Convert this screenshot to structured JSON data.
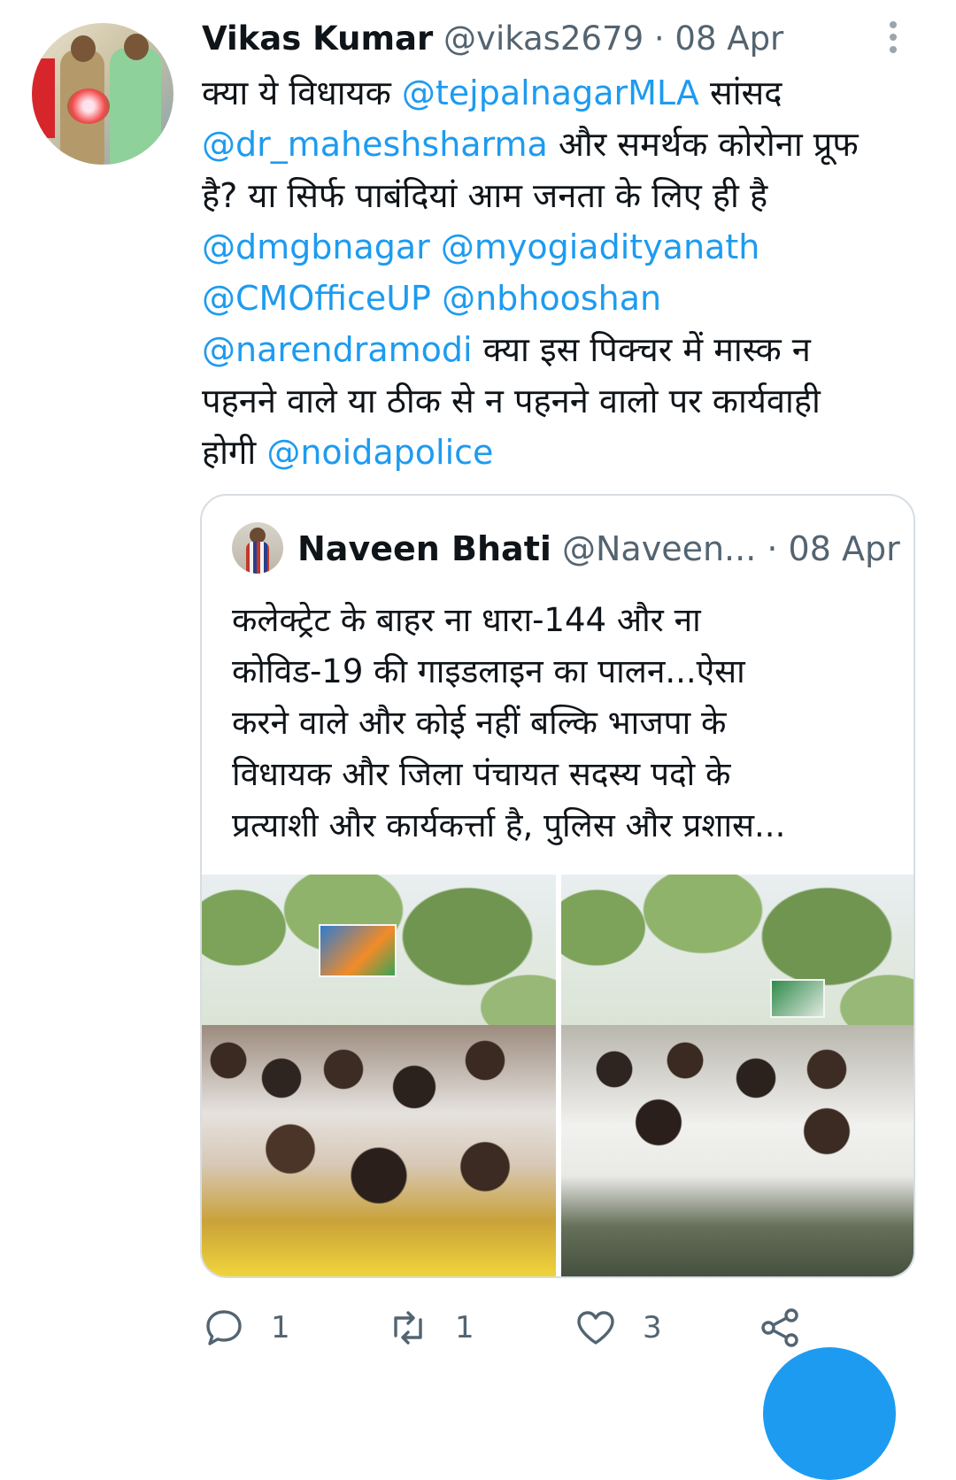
{
  "tweet": {
    "author_name": "Vikas Kumar",
    "author_handle": "@vikas2679",
    "separator": " · ",
    "date": "08 Apr",
    "avatar_icon": "user-avatar-photo",
    "text": {
      "line1_prefix": "क्या ये विधायक ",
      "mention1": "@tejpalnagarMLA",
      "line1_suffix": " सांसद",
      "mention2": "@dr_maheshsharma",
      "line2_suffix": " और समर्थक कोरोना प्रूफ",
      "line3": "है? या सिर्फ पाबंदियां आम जनता के लिए ही है",
      "mention3": "@dmgbnagar",
      "mention4": "@myogiadityanath",
      "mention5": "@CMOfficeUP",
      "mention6": "@nbhooshan",
      "mention7": "@narendramodi",
      "line6_suffix": " क्या इस पिक्चर में मास्क न",
      "line7": "पहनने वाले या ठीक से न पहनने वालो पर कार्यवाही",
      "line8_prefix": "होगी ",
      "mention8": "@noidapolice"
    }
  },
  "quoted_tweet": {
    "author_name": "Naveen Bhati",
    "author_handle": "@Naveen...",
    "separator": " · ",
    "date": "08 Apr",
    "lines": [
      "कलेक्ट्रेट के बाहर ना धारा-144 और ना",
      "कोविड-19 की गाइडलाइन का पालन...ऐसा",
      "करने वाले और कोई नहीं बल्कि भाजपा के",
      "विधायक और जिला पंचायत सदस्य पदो के",
      "प्रत्याशी और कार्यकर्त्ता है, पुलिस और प्रशास..."
    ],
    "media_count": 2
  },
  "actions": {
    "reply_count": "1",
    "retweet_count": "1",
    "like_count": "3"
  },
  "colors": {
    "mention": "#1d9bf0",
    "secondary_text": "#536471",
    "border": "#d7dde2",
    "fab": "#1d9bf0"
  }
}
